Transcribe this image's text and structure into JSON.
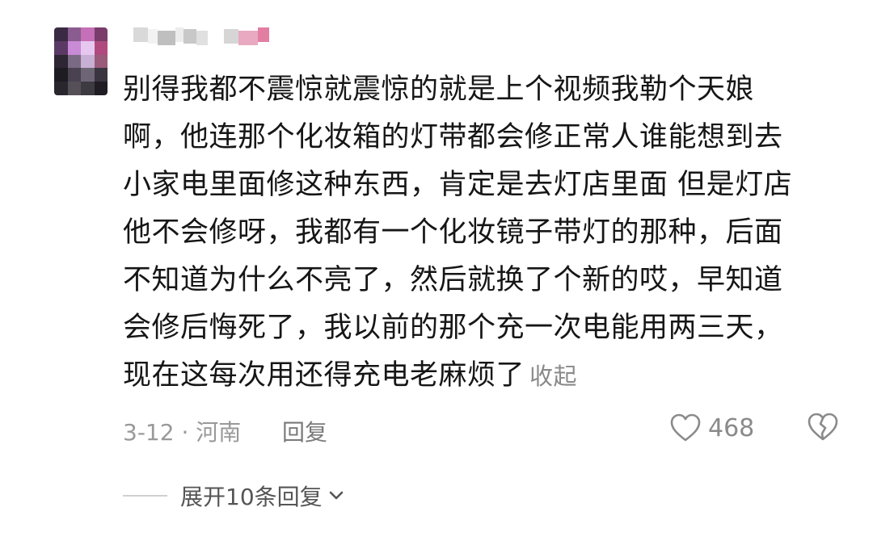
{
  "comment": {
    "avatar_colors": [
      "#3b2a44",
      "#8a5c8f",
      "#c46fb7",
      "#7a3c6a",
      "#5a3a64",
      "#c98ad6",
      "#e6c7f0",
      "#b04a7e",
      "#2e2633",
      "#7b6a84",
      "#c8b0d4",
      "#9a5a7a",
      "#1f1b23",
      "#4a4250",
      "#6e6676",
      "#3a3440",
      "#2a262e",
      "#555058",
      "#3d3a42",
      "#201c24"
    ],
    "username_colors": [
      "#d9d9d9",
      "#f2f2f2",
      "#bfbfbf",
      "#ececec",
      "#c8c8c8",
      "#e0e0e0",
      "#ffffff",
      "#d6d6d6",
      "#e8a9c1",
      "#e37ea3"
    ],
    "text_lines": [
      "别得我都不震惊就震惊的就是上个视频我勒个天娘",
      "啊，他连那个化妆箱的灯带都会修正常人谁能想到去",
      "小家电里面修这种东西，肯定是去灯店里面 但是灯店",
      "他不会修呀，我都有一个化妆镜子带灯的那种，后面",
      "不知道为什么不亮了，然后就换了个新的哎，早知道",
      "会修后悔死了，我以前的那个充一次电能用两三天，",
      "现在这每次用还得充电老麻烦了"
    ],
    "collapse_label": "收起",
    "date_location": "3-12 · 河南",
    "reply_label": "回复",
    "like_count": "468",
    "like_icon": "heart-outline-icon",
    "dislike_icon": "broken-heart-icon"
  },
  "replies": {
    "expand_label": "展开10条回复",
    "chevron_icon": "chevron-down-icon"
  }
}
